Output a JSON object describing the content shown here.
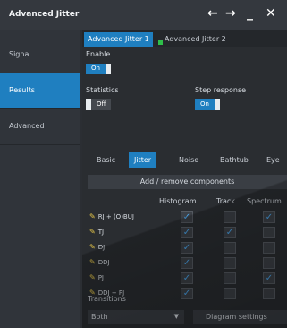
{
  "window": {
    "title": "Advanced Jitter",
    "controls": {
      "back": "←",
      "forward": "→",
      "minimize": "_",
      "close": "✕"
    }
  },
  "sidebar": {
    "items": [
      {
        "label": "Signal",
        "active": false
      },
      {
        "label": "Results",
        "active": true
      },
      {
        "label": "Advanced",
        "active": false
      }
    ]
  },
  "tabs": [
    {
      "label": "Advanced Jitter 1",
      "active": true
    },
    {
      "label": "Advanced Jitter 2",
      "active": false
    }
  ],
  "enable": {
    "label": "Enable",
    "state": "On"
  },
  "statistics": {
    "label": "Statistics",
    "state": "Off"
  },
  "step_response": {
    "label": "Step response",
    "state": "On"
  },
  "subtabs": [
    {
      "label": "Basic",
      "active": false
    },
    {
      "label": "Jitter",
      "active": true
    },
    {
      "label": "Noise",
      "active": false
    },
    {
      "label": "Bathtub",
      "active": false
    },
    {
      "label": "Eye",
      "active": false
    }
  ],
  "add_remove_label": "Add / remove components",
  "columns": [
    "Histogram",
    "Track",
    "Spectrum"
  ],
  "rows": [
    {
      "label": "RJ + (O)BUJ",
      "histogram": true,
      "track": false,
      "spectrum": true
    },
    {
      "label": "TJ",
      "histogram": true,
      "track": true,
      "spectrum": false
    },
    {
      "label": "DJ",
      "histogram": true,
      "track": false,
      "spectrum": false
    },
    {
      "label": "DDJ",
      "histogram": true,
      "track": false,
      "spectrum": false
    },
    {
      "label": "PJ",
      "histogram": true,
      "track": false,
      "spectrum": true
    },
    {
      "label": "DDJ + PJ",
      "histogram": true,
      "track": false,
      "spectrum": false
    }
  ],
  "transitions": {
    "label": "Transitions",
    "value": "Both"
  },
  "diagram_settings_label": "Diagram settings",
  "check_glyph": "✓",
  "pen_glyph": "✎",
  "colors": {
    "accent": "#1f7fc0",
    "green_indicator": "#2fbf4a",
    "pen": "#e7c84a"
  }
}
